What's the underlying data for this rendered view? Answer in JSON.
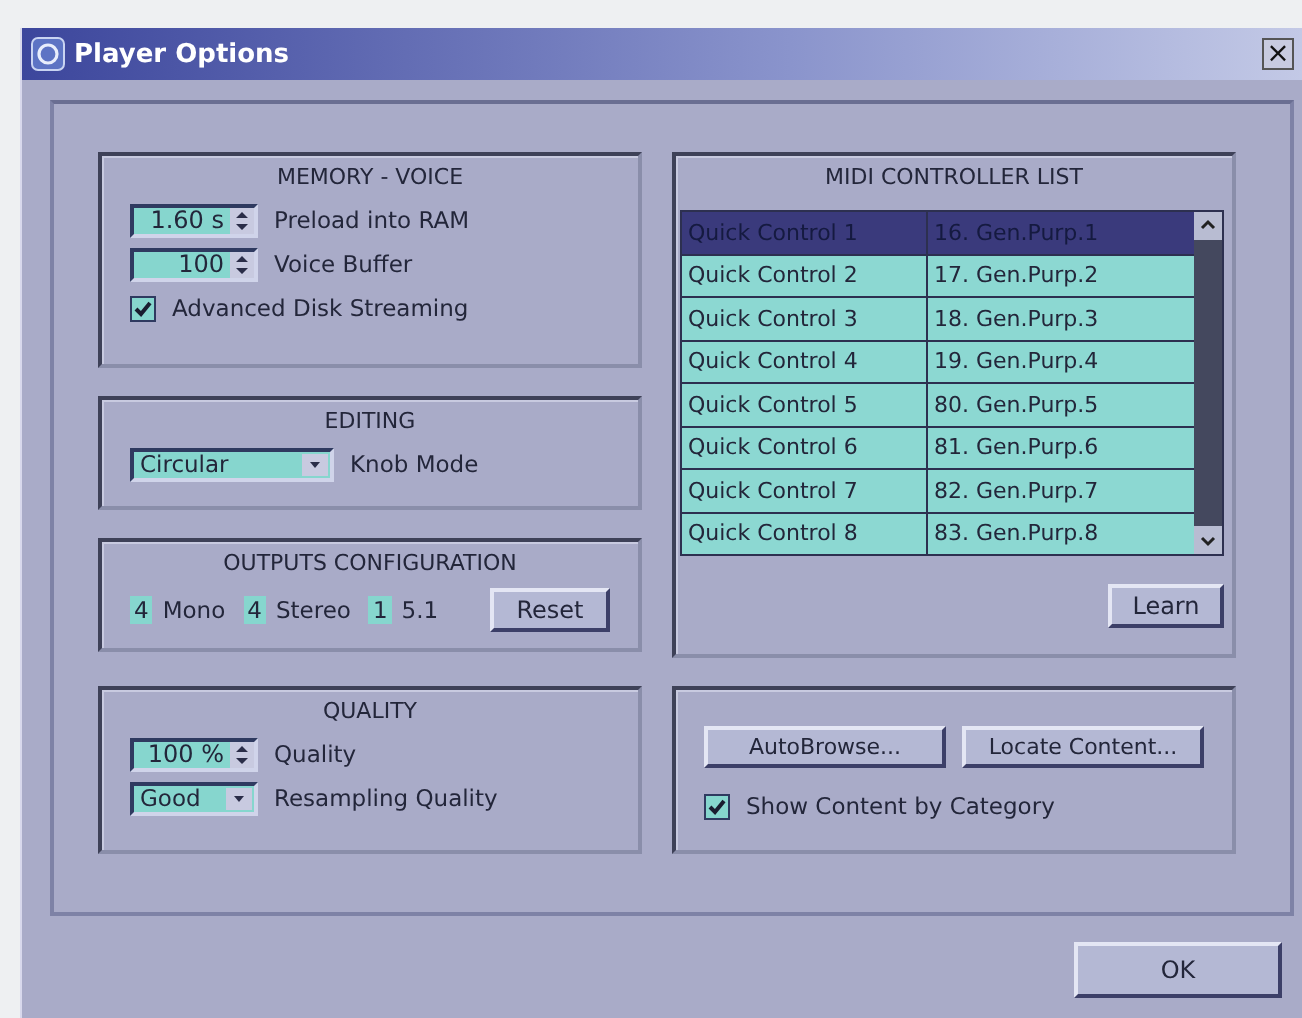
{
  "window": {
    "title": "Player Options",
    "close": "×"
  },
  "memory_voice": {
    "title": "MEMORY - VOICE",
    "fields": [
      {
        "kind": "spin",
        "value": "1.60 s",
        "label": "Preload into RAM"
      },
      {
        "kind": "spin",
        "value": "100",
        "label": "Voice Buffer"
      },
      {
        "kind": "checkbox",
        "checked": true,
        "label": "Advanced Disk Streaming"
      }
    ]
  },
  "editing": {
    "title": "EDITING",
    "fields": [
      {
        "kind": "dropdown",
        "value": "Circular",
        "label": "Knob Mode"
      }
    ]
  },
  "outputs": {
    "title": "OUTPUTS CONFIGURATION",
    "items": [
      {
        "count": "4",
        "label": "Mono"
      },
      {
        "count": "4",
        "label": "Stereo"
      },
      {
        "count": "1",
        "label": "5.1"
      }
    ],
    "reset": "Reset"
  },
  "quality": {
    "title": "QUALITY",
    "fields": [
      {
        "kind": "spin",
        "value": "100 %",
        "label": "Quality"
      },
      {
        "kind": "dropdown",
        "value": "Good",
        "label": "Resampling Quality"
      }
    ]
  },
  "midi": {
    "title": "MIDI CONTROLLER LIST",
    "rows": [
      {
        "control": "Quick Control 1",
        "assignment": "16. Gen.Purp.1",
        "selected": true
      },
      {
        "control": "Quick Control 2",
        "assignment": "17. Gen.Purp.2",
        "selected": false
      },
      {
        "control": "Quick Control 3",
        "assignment": "18. Gen.Purp.3",
        "selected": false
      },
      {
        "control": "Quick Control 4",
        "assignment": "19. Gen.Purp.4",
        "selected": false
      },
      {
        "control": "Quick Control 5",
        "assignment": "80. Gen.Purp.5",
        "selected": false
      },
      {
        "control": "Quick Control 6",
        "assignment": "81. Gen.Purp.6",
        "selected": false
      },
      {
        "control": "Quick Control 7",
        "assignment": "82. Gen.Purp.7",
        "selected": false
      },
      {
        "control": "Quick Control 8",
        "assignment": "83. Gen.Purp.8",
        "selected": false
      }
    ],
    "learn": "Learn"
  },
  "content": {
    "buttons": [
      "AutoBrowse...",
      "Locate Content..."
    ],
    "checkbox": {
      "label": "Show Content by Category",
      "checked": true
    }
  },
  "ok": "OK"
}
